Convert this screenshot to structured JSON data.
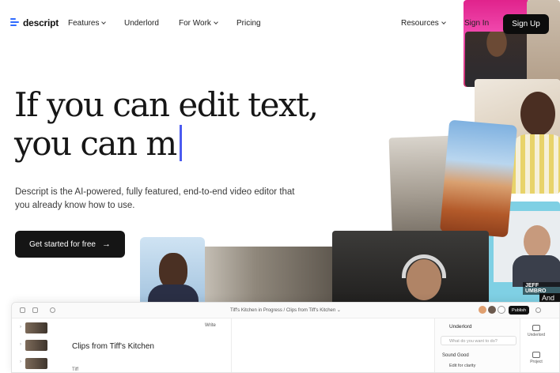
{
  "brand": {
    "name": "descript"
  },
  "nav": {
    "features": "Features",
    "underlord": "Underlord",
    "for_work": "For Work",
    "pricing": "Pricing",
    "resources": "Resources",
    "sign_in": "Sign In",
    "sign_up": "Sign Up"
  },
  "hero": {
    "line1": "If you can edit text,",
    "line2": "you can m",
    "subtitle": "Descript is the AI-powered, fully featured, end-to-end video editor that you already know how to use.",
    "cta": "Get started for free",
    "cta_icon": "→"
  },
  "collage": {
    "name_tag": "JEFF UMBRO",
    "caption": "And t"
  },
  "app": {
    "breadcrumb": "Tiff's Kitchen in Progress  /  Clips from Tiff's Kitchen  ⌄",
    "publish": "Publish",
    "write": "Write",
    "doc_title": "Clips from Tiff's Kitchen",
    "speaker": "Tiff",
    "underlord_title": "Underlord",
    "search_placeholder": "What do you want to do?",
    "sound_good": "Sound Good",
    "edit_for_clarity": "Edit for clarity",
    "rail_underlord": "Underlord",
    "rail_project": "Project"
  },
  "colors": {
    "accent": "#4b5bf0",
    "brand_blue": "#2f6bff",
    "button_dark": "#151515"
  }
}
